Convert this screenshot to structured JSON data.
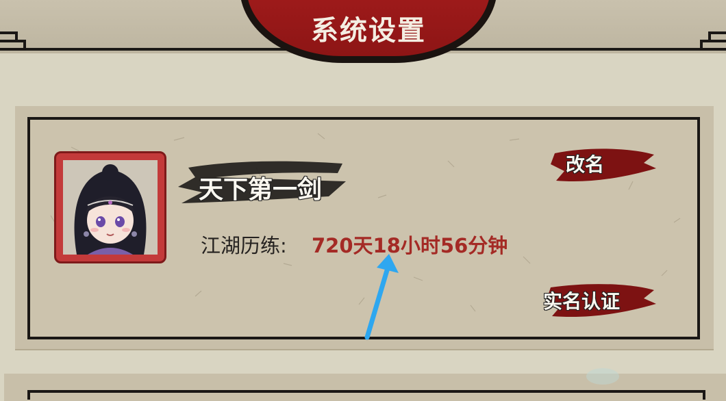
{
  "header": {
    "title": "系统设置"
  },
  "profile": {
    "name": "天下第一剑",
    "experience_label": "江湖历练:",
    "experience_value": "720天18小时56分钟"
  },
  "buttons": {
    "rename": "改名",
    "verify": "实名认证"
  },
  "colors": {
    "accent_red": "#a31c1c",
    "value_red": "#a42a25",
    "paper": "#ccc3ad",
    "ink": "#1a1715",
    "annotation_arrow": "#2ea7f0"
  },
  "icons": [
    "avatar-portrait",
    "annotation-arrow"
  ]
}
